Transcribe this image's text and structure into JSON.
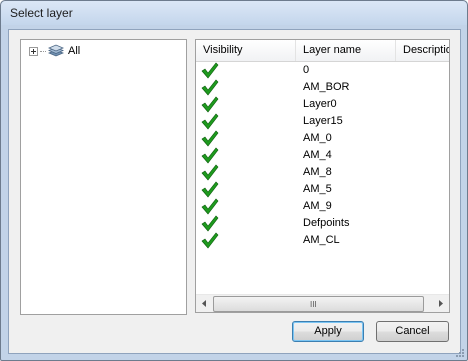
{
  "window": {
    "title": "Select layer"
  },
  "tree": {
    "root_label": "All"
  },
  "list": {
    "columns": [
      "Visibility",
      "Layer name",
      "Description"
    ],
    "rows": [
      {
        "visible": true,
        "name": "0"
      },
      {
        "visible": true,
        "name": "AM_BOR"
      },
      {
        "visible": true,
        "name": "Layer0"
      },
      {
        "visible": true,
        "name": "Layer15"
      },
      {
        "visible": true,
        "name": "AM_0"
      },
      {
        "visible": true,
        "name": "AM_4"
      },
      {
        "visible": true,
        "name": "AM_8"
      },
      {
        "visible": true,
        "name": "AM_5"
      },
      {
        "visible": true,
        "name": "AM_9"
      },
      {
        "visible": true,
        "name": "Defpoints"
      },
      {
        "visible": true,
        "name": "AM_CL"
      }
    ],
    "scrollbar_grip": "III"
  },
  "buttons": {
    "apply": "Apply",
    "cancel": "Cancel"
  },
  "colors": {
    "check": "#1e9a1e",
    "accent": "#3c7fb1"
  },
  "icons": {
    "tree_expand": "plus-box-icon",
    "tree_node": "layers-icon",
    "visibility": "checkmark-icon"
  }
}
